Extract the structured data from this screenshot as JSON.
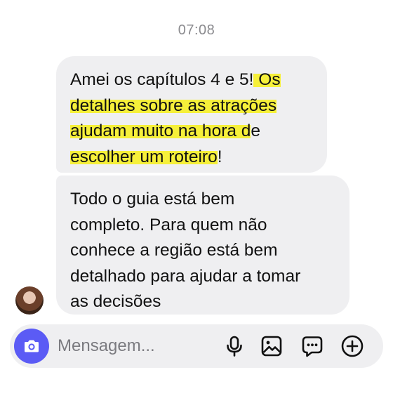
{
  "chat": {
    "timestamp": "07:08",
    "messages": [
      {
        "sender": "me",
        "lines": [
          [
            {
              "text": "Amei os capítulos 4 e 5!"
            },
            {
              "text": " Os",
              "highlight": true
            }
          ],
          [
            {
              "text": "detalhes sobre as atrações",
              "highlight": true
            }
          ],
          [
            {
              "text": "ajudam muito na hora d",
              "highlight": true
            },
            {
              "text": "e"
            }
          ],
          [
            {
              "text": "escolher um roteiro",
              "highlight": true
            },
            {
              "text": "!"
            }
          ]
        ]
      },
      {
        "sender": "contact",
        "lines": [
          "Todo o guia está bem",
          "completo. Para quem não",
          "conhece a região está bem",
          "detalhado para ajudar a tomar",
          "as decisões"
        ]
      }
    ]
  },
  "composer": {
    "placeholder": "Mensagem..."
  },
  "icons": {
    "camera": "camera-icon",
    "microphone": "microphone-icon",
    "gallery": "image-icon",
    "sticker": "chat-bubble-icon",
    "add": "plus-circle-icon"
  },
  "colors": {
    "bubble": "#efeff1",
    "highlight": "#f6f03a",
    "camera_button": "#5b5bf5"
  }
}
